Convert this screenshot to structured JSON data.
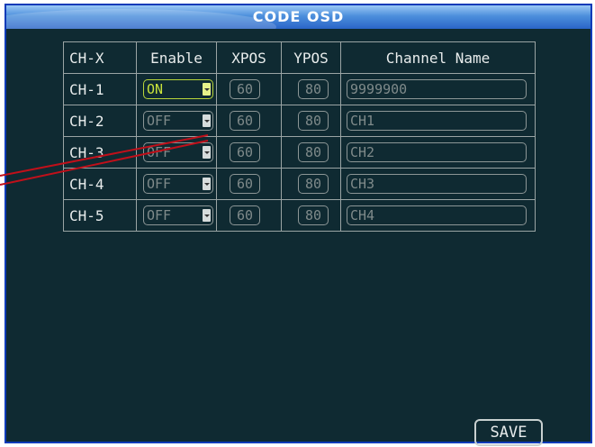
{
  "window": {
    "title": "CODE OSD"
  },
  "table": {
    "headers": [
      "CH-X",
      "Enable",
      "XPOS",
      "YPOS",
      "Channel Name"
    ],
    "rows": [
      {
        "channel": "CH-1",
        "enable": "ON",
        "xpos": "60",
        "ypos": "80",
        "name": "9999900"
      },
      {
        "channel": "CH-2",
        "enable": "OFF",
        "xpos": "60",
        "ypos": "80",
        "name": "CH1"
      },
      {
        "channel": "CH-3",
        "enable": "OFF",
        "xpos": "60",
        "ypos": "80",
        "name": "CH2"
      },
      {
        "channel": "CH-4",
        "enable": "OFF",
        "xpos": "60",
        "ypos": "80",
        "name": "CH3"
      },
      {
        "channel": "CH-5",
        "enable": "OFF",
        "xpos": "60",
        "ypos": "80",
        "name": "CH4"
      }
    ]
  },
  "actions": {
    "save_label": "SAVE"
  },
  "colors": {
    "background": "#0f2a32",
    "title_bar": "#4c8fdc",
    "enabled_highlight": "#c9e33b",
    "pointer_line": "#c0101a"
  },
  "icons": {
    "dropdown": "dropdown-arrow-icon"
  }
}
